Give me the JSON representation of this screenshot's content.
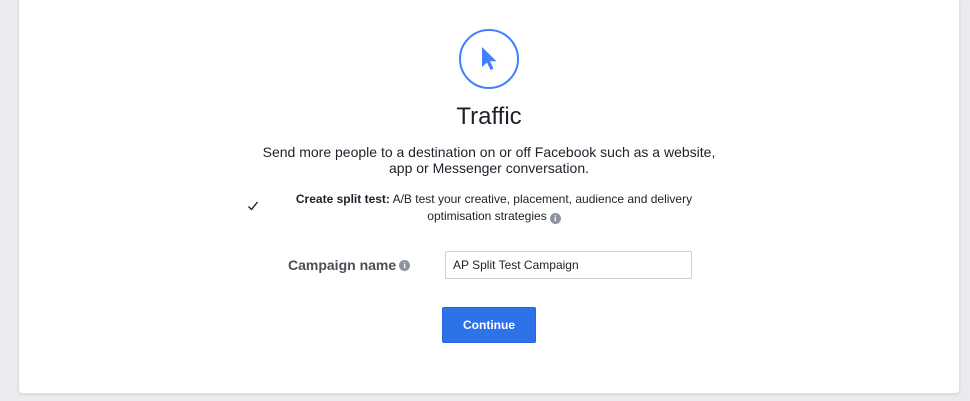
{
  "objective": {
    "icon": "cursor-pointer-icon",
    "title": "Traffic",
    "description_line1": "Send more people to a destination on or off Facebook such as a website,",
    "description_line2": "app or Messenger conversation."
  },
  "split_test": {
    "checked": true,
    "label": "Create split test:",
    "description": "A/B test your creative, placement, audience and delivery optimisation strategies",
    "info_icon": "info-icon"
  },
  "campaign_name": {
    "label": "Campaign name",
    "info_icon": "info-icon",
    "value": "AP Split Test Campaign"
  },
  "continue_button": {
    "label": "Continue"
  },
  "colors": {
    "accent": "#4080ff",
    "button": "#2d72e8",
    "page_bg": "#e9ebee"
  }
}
